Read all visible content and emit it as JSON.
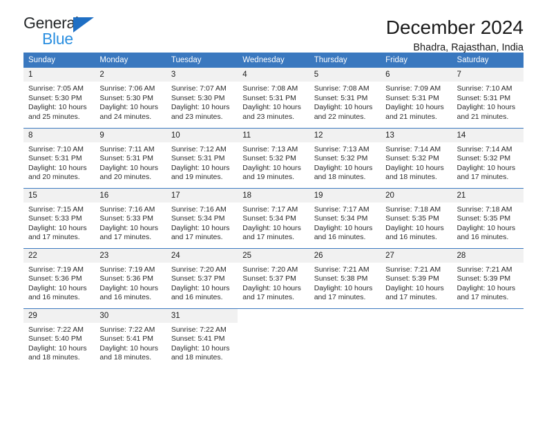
{
  "logo": {
    "word_top": "General",
    "word_bottom": "Blue",
    "triangle_color": "#1f6fc4",
    "blue_text_color": "#2b8fe0"
  },
  "header": {
    "title": "December 2024",
    "subtitle": "Bhadra, Rajasthan, India",
    "accent_color": "#3a78bf"
  },
  "calendar": {
    "weekday_headers": [
      "Sunday",
      "Monday",
      "Tuesday",
      "Wednesday",
      "Thursday",
      "Friday",
      "Saturday"
    ],
    "weeks": [
      [
        {
          "day": "1",
          "sunrise": "Sunrise: 7:05 AM",
          "sunset": "Sunset: 5:30 PM",
          "daylight_line1": "Daylight: 10 hours",
          "daylight_line2": "and 25 minutes."
        },
        {
          "day": "2",
          "sunrise": "Sunrise: 7:06 AM",
          "sunset": "Sunset: 5:30 PM",
          "daylight_line1": "Daylight: 10 hours",
          "daylight_line2": "and 24 minutes."
        },
        {
          "day": "3",
          "sunrise": "Sunrise: 7:07 AM",
          "sunset": "Sunset: 5:30 PM",
          "daylight_line1": "Daylight: 10 hours",
          "daylight_line2": "and 23 minutes."
        },
        {
          "day": "4",
          "sunrise": "Sunrise: 7:08 AM",
          "sunset": "Sunset: 5:31 PM",
          "daylight_line1": "Daylight: 10 hours",
          "daylight_line2": "and 23 minutes."
        },
        {
          "day": "5",
          "sunrise": "Sunrise: 7:08 AM",
          "sunset": "Sunset: 5:31 PM",
          "daylight_line1": "Daylight: 10 hours",
          "daylight_line2": "and 22 minutes."
        },
        {
          "day": "6",
          "sunrise": "Sunrise: 7:09 AM",
          "sunset": "Sunset: 5:31 PM",
          "daylight_line1": "Daylight: 10 hours",
          "daylight_line2": "and 21 minutes."
        },
        {
          "day": "7",
          "sunrise": "Sunrise: 7:10 AM",
          "sunset": "Sunset: 5:31 PM",
          "daylight_line1": "Daylight: 10 hours",
          "daylight_line2": "and 21 minutes."
        }
      ],
      [
        {
          "day": "8",
          "sunrise": "Sunrise: 7:10 AM",
          "sunset": "Sunset: 5:31 PM",
          "daylight_line1": "Daylight: 10 hours",
          "daylight_line2": "and 20 minutes."
        },
        {
          "day": "9",
          "sunrise": "Sunrise: 7:11 AM",
          "sunset": "Sunset: 5:31 PM",
          "daylight_line1": "Daylight: 10 hours",
          "daylight_line2": "and 20 minutes."
        },
        {
          "day": "10",
          "sunrise": "Sunrise: 7:12 AM",
          "sunset": "Sunset: 5:31 PM",
          "daylight_line1": "Daylight: 10 hours",
          "daylight_line2": "and 19 minutes."
        },
        {
          "day": "11",
          "sunrise": "Sunrise: 7:13 AM",
          "sunset": "Sunset: 5:32 PM",
          "daylight_line1": "Daylight: 10 hours",
          "daylight_line2": "and 19 minutes."
        },
        {
          "day": "12",
          "sunrise": "Sunrise: 7:13 AM",
          "sunset": "Sunset: 5:32 PM",
          "daylight_line1": "Daylight: 10 hours",
          "daylight_line2": "and 18 minutes."
        },
        {
          "day": "13",
          "sunrise": "Sunrise: 7:14 AM",
          "sunset": "Sunset: 5:32 PM",
          "daylight_line1": "Daylight: 10 hours",
          "daylight_line2": "and 18 minutes."
        },
        {
          "day": "14",
          "sunrise": "Sunrise: 7:14 AM",
          "sunset": "Sunset: 5:32 PM",
          "daylight_line1": "Daylight: 10 hours",
          "daylight_line2": "and 17 minutes."
        }
      ],
      [
        {
          "day": "15",
          "sunrise": "Sunrise: 7:15 AM",
          "sunset": "Sunset: 5:33 PM",
          "daylight_line1": "Daylight: 10 hours",
          "daylight_line2": "and 17 minutes."
        },
        {
          "day": "16",
          "sunrise": "Sunrise: 7:16 AM",
          "sunset": "Sunset: 5:33 PM",
          "daylight_line1": "Daylight: 10 hours",
          "daylight_line2": "and 17 minutes."
        },
        {
          "day": "17",
          "sunrise": "Sunrise: 7:16 AM",
          "sunset": "Sunset: 5:34 PM",
          "daylight_line1": "Daylight: 10 hours",
          "daylight_line2": "and 17 minutes."
        },
        {
          "day": "18",
          "sunrise": "Sunrise: 7:17 AM",
          "sunset": "Sunset: 5:34 PM",
          "daylight_line1": "Daylight: 10 hours",
          "daylight_line2": "and 17 minutes."
        },
        {
          "day": "19",
          "sunrise": "Sunrise: 7:17 AM",
          "sunset": "Sunset: 5:34 PM",
          "daylight_line1": "Daylight: 10 hours",
          "daylight_line2": "and 16 minutes."
        },
        {
          "day": "20",
          "sunrise": "Sunrise: 7:18 AM",
          "sunset": "Sunset: 5:35 PM",
          "daylight_line1": "Daylight: 10 hours",
          "daylight_line2": "and 16 minutes."
        },
        {
          "day": "21",
          "sunrise": "Sunrise: 7:18 AM",
          "sunset": "Sunset: 5:35 PM",
          "daylight_line1": "Daylight: 10 hours",
          "daylight_line2": "and 16 minutes."
        }
      ],
      [
        {
          "day": "22",
          "sunrise": "Sunrise: 7:19 AM",
          "sunset": "Sunset: 5:36 PM",
          "daylight_line1": "Daylight: 10 hours",
          "daylight_line2": "and 16 minutes."
        },
        {
          "day": "23",
          "sunrise": "Sunrise: 7:19 AM",
          "sunset": "Sunset: 5:36 PM",
          "daylight_line1": "Daylight: 10 hours",
          "daylight_line2": "and 16 minutes."
        },
        {
          "day": "24",
          "sunrise": "Sunrise: 7:20 AM",
          "sunset": "Sunset: 5:37 PM",
          "daylight_line1": "Daylight: 10 hours",
          "daylight_line2": "and 16 minutes."
        },
        {
          "day": "25",
          "sunrise": "Sunrise: 7:20 AM",
          "sunset": "Sunset: 5:37 PM",
          "daylight_line1": "Daylight: 10 hours",
          "daylight_line2": "and 17 minutes."
        },
        {
          "day": "26",
          "sunrise": "Sunrise: 7:21 AM",
          "sunset": "Sunset: 5:38 PM",
          "daylight_line1": "Daylight: 10 hours",
          "daylight_line2": "and 17 minutes."
        },
        {
          "day": "27",
          "sunrise": "Sunrise: 7:21 AM",
          "sunset": "Sunset: 5:39 PM",
          "daylight_line1": "Daylight: 10 hours",
          "daylight_line2": "and 17 minutes."
        },
        {
          "day": "28",
          "sunrise": "Sunrise: 7:21 AM",
          "sunset": "Sunset: 5:39 PM",
          "daylight_line1": "Daylight: 10 hours",
          "daylight_line2": "and 17 minutes."
        }
      ],
      [
        {
          "day": "29",
          "sunrise": "Sunrise: 7:22 AM",
          "sunset": "Sunset: 5:40 PM",
          "daylight_line1": "Daylight: 10 hours",
          "daylight_line2": "and 18 minutes."
        },
        {
          "day": "30",
          "sunrise": "Sunrise: 7:22 AM",
          "sunset": "Sunset: 5:41 PM",
          "daylight_line1": "Daylight: 10 hours",
          "daylight_line2": "and 18 minutes."
        },
        {
          "day": "31",
          "sunrise": "Sunrise: 7:22 AM",
          "sunset": "Sunset: 5:41 PM",
          "daylight_line1": "Daylight: 10 hours",
          "daylight_line2": "and 18 minutes."
        },
        {
          "day": "",
          "sunrise": "",
          "sunset": "",
          "daylight_line1": "",
          "daylight_line2": ""
        },
        {
          "day": "",
          "sunrise": "",
          "sunset": "",
          "daylight_line1": "",
          "daylight_line2": ""
        },
        {
          "day": "",
          "sunrise": "",
          "sunset": "",
          "daylight_line1": "",
          "daylight_line2": ""
        },
        {
          "day": "",
          "sunrise": "",
          "sunset": "",
          "daylight_line1": "",
          "daylight_line2": ""
        }
      ]
    ]
  }
}
